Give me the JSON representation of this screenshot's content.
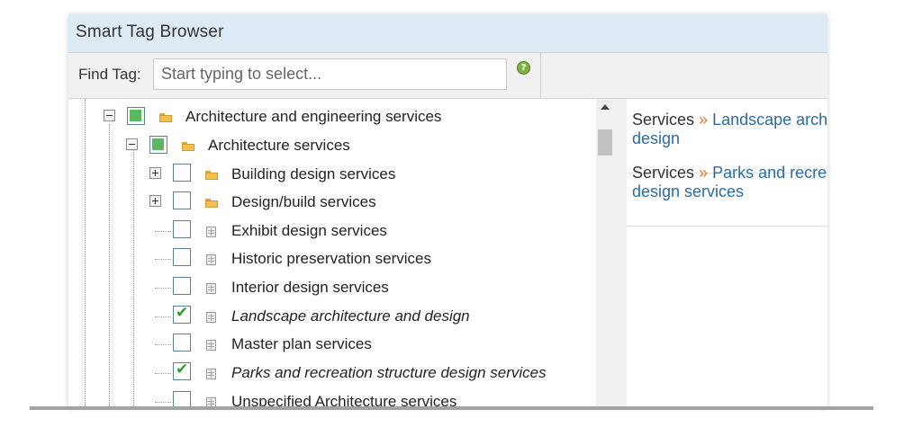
{
  "window": {
    "title": "Smart Tag Browser"
  },
  "find": {
    "label": "Find Tag:",
    "placeholder": "Start typing to select..."
  },
  "tree": {
    "root": {
      "label": "Architecture and engineering services",
      "state": "partial",
      "expanded": true
    },
    "child": {
      "label": "Architecture services",
      "state": "partial",
      "expanded": true
    },
    "items": [
      {
        "label": "Building design services",
        "checked": false,
        "type": "folder",
        "expandable": true,
        "italic": false
      },
      {
        "label": "Design/build services",
        "checked": false,
        "type": "folder",
        "expandable": true,
        "italic": false
      },
      {
        "label": "Exhibit design services",
        "checked": false,
        "type": "leaf",
        "expandable": false,
        "italic": false
      },
      {
        "label": "Historic preservation services",
        "checked": false,
        "type": "leaf",
        "expandable": false,
        "italic": false
      },
      {
        "label": "Interior design services",
        "checked": false,
        "type": "leaf",
        "expandable": false,
        "italic": false
      },
      {
        "label": "Landscape architecture and design",
        "checked": true,
        "type": "leaf",
        "expandable": false,
        "italic": true
      },
      {
        "label": "Master plan services",
        "checked": false,
        "type": "leaf",
        "expandable": false,
        "italic": false
      },
      {
        "label": "Parks and recreation structure design services",
        "checked": true,
        "type": "leaf",
        "expandable": false,
        "italic": true
      },
      {
        "label": "Unspecified Architecture services",
        "checked": false,
        "type": "leaf",
        "expandable": false,
        "italic": false
      }
    ]
  },
  "selected": [
    {
      "prefix": "Services",
      "sep": "»",
      "line1": "Landscape archite",
      "line2": "design"
    },
    {
      "prefix": "Services",
      "sep": "»",
      "line1": "Parks and recreati",
      "line2": "design services"
    }
  ],
  "colors": {
    "title_bar": "#deebf5",
    "link": "#2a6ca6",
    "separator": "#e07b1e",
    "check": "#2f9e2f",
    "partial": "#5cb85c"
  },
  "icons": {
    "help": "help-icon",
    "folder": "folder-icon",
    "leaf": "tag-leaf-icon"
  }
}
